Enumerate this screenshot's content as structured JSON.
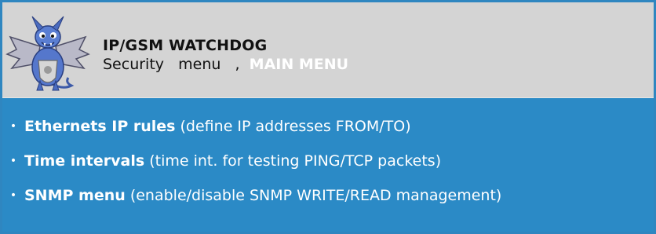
{
  "header": {
    "app_title": "IP/GSM WATCHDOG",
    "subtitle_prefix": "Security   menu   ,  ",
    "main_menu_link": "MAIN MENU"
  },
  "menu": {
    "bullet": "•",
    "items": [
      {
        "label": "Ethernets IP rules",
        "description": " (define IP addresses FROM/TO)"
      },
      {
        "label": "Time intervals",
        "description": " (time int. for testing PING/TCP packets)"
      },
      {
        "label": "SNMP menu",
        "description": " (enable/disable SNMP WRITE/READ management)"
      }
    ]
  },
  "colors": {
    "header_background": "#d4d4d4",
    "body_background": "#2b8ac6",
    "border": "#2f86c0",
    "link_text": "#ffffff"
  },
  "icons": {
    "logo": "dragon-mascot-icon"
  }
}
